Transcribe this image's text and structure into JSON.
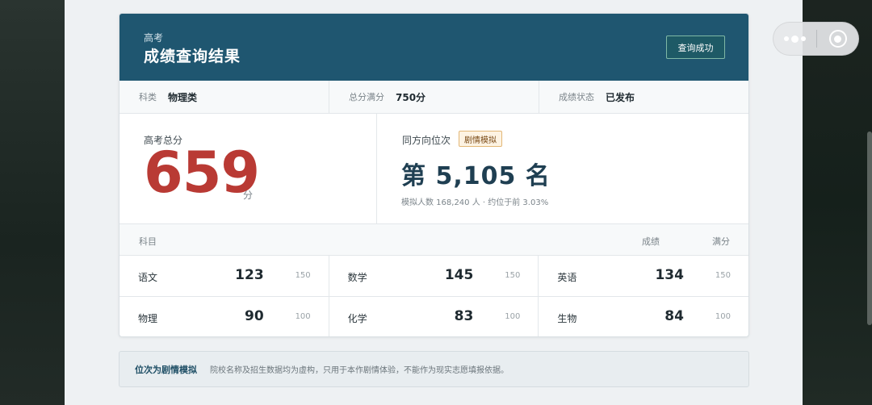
{
  "header": {
    "subtitle": "高考",
    "title": "成绩查询结果",
    "status_button": "查询成功"
  },
  "meta": [
    {
      "label": "科类",
      "value": "物理类"
    },
    {
      "label": "总分满分",
      "value": "750分"
    },
    {
      "label": "成绩状态",
      "value": "已发布"
    }
  ],
  "total": {
    "label": "高考总分",
    "score": "659",
    "unit": "分"
  },
  "rank": {
    "label": "同方向位次",
    "badge": "剧情模拟",
    "value": "第 5,105 名",
    "note": "模拟人数 168,240 人 · 约位于前 3.03%"
  },
  "subjects_header": {
    "subject": "科目",
    "score": "成绩",
    "full": "满分"
  },
  "subjects": [
    {
      "name": "语文",
      "score": "123",
      "full": "150"
    },
    {
      "name": "数学",
      "score": "145",
      "full": "150"
    },
    {
      "name": "英语",
      "score": "134",
      "full": "150"
    },
    {
      "name": "物理",
      "score": "90",
      "full": "100"
    },
    {
      "name": "化学",
      "score": "83",
      "full": "100"
    },
    {
      "name": "生物",
      "score": "84",
      "full": "100"
    }
  ],
  "notice": {
    "title": "位次为剧情模拟",
    "text": "院校名称及招生数据均为虚构，只用于本作剧情体验，不能作为现实志愿填报依据。"
  },
  "capsule": {
    "more_icon": "more-dots-icon",
    "close_icon": "close-circle-icon"
  },
  "colors": {
    "header_bg": "#1f5670",
    "score_red": "#b93a34",
    "rank_navy": "#1f3f52"
  }
}
